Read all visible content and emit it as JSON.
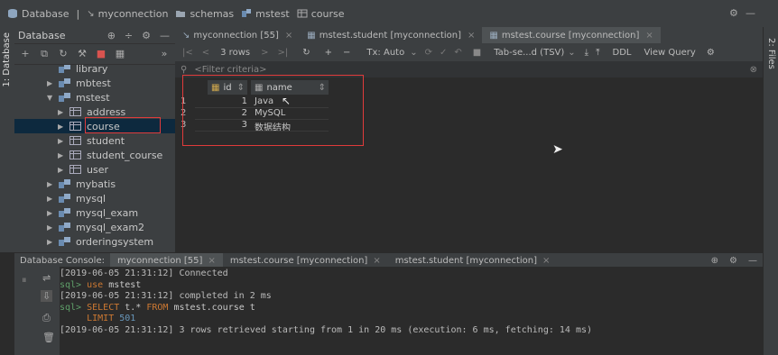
{
  "breadcrumb": [
    "Database",
    "myconnection",
    "schemas",
    "mstest",
    "course"
  ],
  "left_stripe_label": "1: Database",
  "right_stripe_label": "2: Files",
  "db_panel": {
    "title": "Database",
    "tree": [
      {
        "label": "library",
        "level": 1,
        "arrow": "",
        "type": "schema"
      },
      {
        "label": "mbtest",
        "level": 1,
        "arrow": "▶",
        "type": "schema"
      },
      {
        "label": "mstest",
        "level": 1,
        "arrow": "▼",
        "type": "schema"
      },
      {
        "label": "address",
        "level": 2,
        "arrow": "▶",
        "type": "table"
      },
      {
        "label": "course",
        "level": 2,
        "arrow": "▶",
        "type": "table",
        "selected": true
      },
      {
        "label": "student",
        "level": 2,
        "arrow": "▶",
        "type": "table"
      },
      {
        "label": "student_course",
        "level": 2,
        "arrow": "▶",
        "type": "table"
      },
      {
        "label": "user",
        "level": 2,
        "arrow": "▶",
        "type": "table"
      },
      {
        "label": "mybatis",
        "level": 1,
        "arrow": "▶",
        "type": "schema"
      },
      {
        "label": "mysql",
        "level": 1,
        "arrow": "▶",
        "type": "schema"
      },
      {
        "label": "mysql_exam",
        "level": 1,
        "arrow": "▶",
        "type": "schema"
      },
      {
        "label": "mysql_exam2",
        "level": 1,
        "arrow": "▶",
        "type": "schema"
      },
      {
        "label": "orderingsystem",
        "level": 1,
        "arrow": "▶",
        "type": "schema"
      }
    ]
  },
  "editor_tabs": [
    {
      "label": "myconnection [55]",
      "active": false
    },
    {
      "label": "mstest.student [myconnection]",
      "active": false
    },
    {
      "label": "mstest.course [myconnection]",
      "active": true
    }
  ],
  "grid_toolbar": {
    "rows": "3 rows",
    "tx": "Tx: Auto",
    "format": "Tab-se...d (TSV)",
    "ddl": "DDL",
    "view_query": "View Query"
  },
  "filter_placeholder": "<Filter criteria>",
  "result_grid": {
    "columns": [
      "id",
      "name"
    ],
    "rows": [
      {
        "num": "1",
        "id": "1",
        "name": "Java"
      },
      {
        "num": "2",
        "id": "2",
        "name": "MySQL"
      },
      {
        "num": "3",
        "id": "3",
        "name": "数据结构"
      }
    ]
  },
  "console": {
    "label": "Database Console:",
    "tabs": [
      {
        "label": "myconnection [55]",
        "active": true
      },
      {
        "label": "mstest.course [myconnection]",
        "active": false
      },
      {
        "label": "mstest.student [myconnection]",
        "active": false
      }
    ],
    "lines": [
      {
        "prefix": "",
        "text": "[2019-06-05 21:31:12] Connected",
        "kind": "log"
      },
      {
        "prefix": "sql> ",
        "text": "use mstest",
        "kind": "sql"
      },
      {
        "prefix": "",
        "text": "[2019-06-05 21:31:12] completed in 2 ms",
        "kind": "log"
      },
      {
        "prefix": "sql> ",
        "text": "SELECT t.* FROM mstest.course t",
        "kind": "sql"
      },
      {
        "prefix": "     ",
        "text": "LIMIT 501",
        "kind": "sql"
      },
      {
        "prefix": "",
        "text": "[2019-06-05 21:31:12] 3 rows retrieved starting from 1 in 20 ms (execution: 6 ms, fetching: 14 ms)",
        "kind": "log"
      }
    ]
  },
  "colors": {
    "accent": "#4a88c7",
    "highlight_box": "#e03b3b",
    "sql_prompt": "#5fa06a",
    "keyword": "#cc7832"
  }
}
